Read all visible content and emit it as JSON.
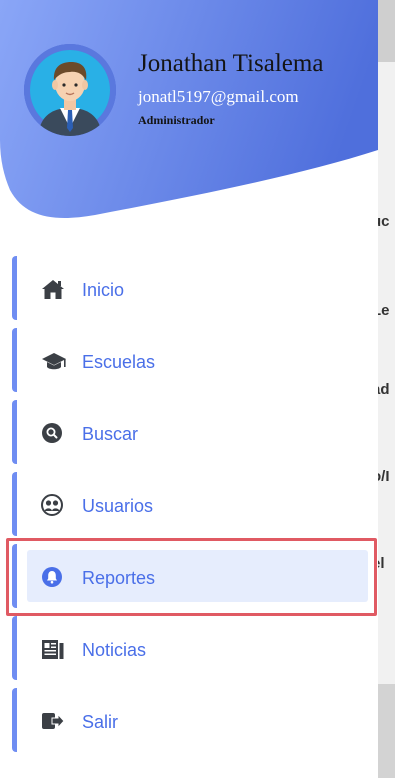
{
  "user": {
    "name": "Jonathan Tisalema",
    "email": "jonatl5197@gmail.com",
    "role": "Administrador"
  },
  "menu": {
    "items": [
      {
        "label": "Inicio",
        "icon": "home-icon",
        "active": false
      },
      {
        "label": "Escuelas",
        "icon": "graduation-cap-icon",
        "active": false
      },
      {
        "label": "Buscar",
        "icon": "search-icon",
        "active": false
      },
      {
        "label": "Usuarios",
        "icon": "users-icon",
        "active": false
      },
      {
        "label": "Reportes",
        "icon": "bell-icon",
        "active": true
      },
      {
        "label": "Noticias",
        "icon": "newspaper-icon",
        "active": false
      },
      {
        "label": "Salir",
        "icon": "sign-out-icon",
        "active": false
      }
    ]
  },
  "background": {
    "text_fragments": [
      "uc",
      "Le",
      "ad",
      "o/I",
      "el"
    ]
  },
  "colors": {
    "accent": "#4a6fe8",
    "active_bg": "#e6edfd",
    "header_gradient_start": "#8aa6f7",
    "header_gradient_end": "#4f6fdc",
    "highlight": "#e05a63"
  }
}
